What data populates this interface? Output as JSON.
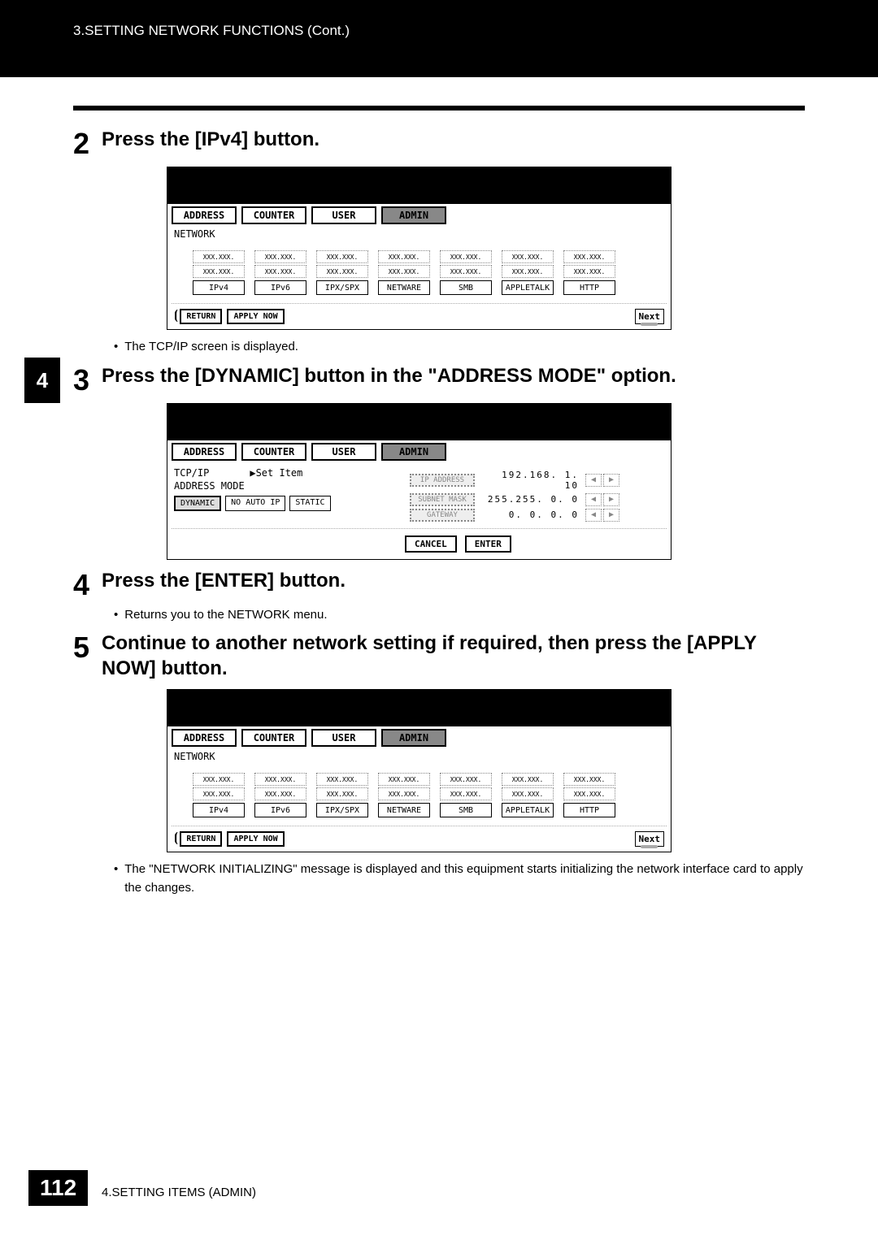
{
  "header": {
    "breadcrumb": "3.SETTING NETWORK FUNCTIONS (Cont.)"
  },
  "sidebar": {
    "tab_num": "4"
  },
  "steps": {
    "s2": {
      "num": "2",
      "title": "Press the [IPv4] button.",
      "bullet": "The TCP/IP screen is displayed."
    },
    "s3": {
      "num": "3",
      "title": "Press the [DYNAMIC] button in the \"ADDRESS MODE\" option."
    },
    "s4": {
      "num": "4",
      "title": "Press the [ENTER] button.",
      "bullet": "Returns you to the NETWORK menu."
    },
    "s5": {
      "num": "5",
      "title": "Continue to another network setting if required, then press the [APPLY NOW] button.",
      "bullet": "The \"NETWORK INITIALIZING\" message is displayed and this equipment starts initializing the network interface card to apply the changes."
    }
  },
  "screen_tabs": {
    "address": "ADDRESS",
    "counter": "COUNTER",
    "user": "USER",
    "admin": "ADMIN"
  },
  "network_screen": {
    "title": "NETWORK",
    "mini_placeholder": "XXX.XXX.",
    "btns": [
      "IPv4",
      "IPv6",
      "IPX/SPX",
      "NETWARE",
      "SMB",
      "APPLETALK",
      "HTTP"
    ],
    "return": "RETURN",
    "apply_now": "APPLY NOW",
    "next": "Next"
  },
  "tcpip_screen": {
    "title": "TCP/IP",
    "set_item": "▶Set Item",
    "address_mode": "ADDRESS MODE",
    "modes": {
      "dynamic": "DYNAMIC",
      "no_auto_ip": "NO AUTO IP",
      "static": "STATIC"
    },
    "ip_address_label": "IP ADDRESS",
    "subnet_label": "SUBNET MASK",
    "gateway_label": "GATEWAY",
    "ip_value": "192.168.  1. 10",
    "subnet_value": "255.255.  0.  0",
    "gateway_value": "  0.  0.  0.  0",
    "cancel": "CANCEL",
    "enter": "ENTER"
  },
  "footer": {
    "page": "112",
    "section": "4.SETTING ITEMS (ADMIN)"
  }
}
